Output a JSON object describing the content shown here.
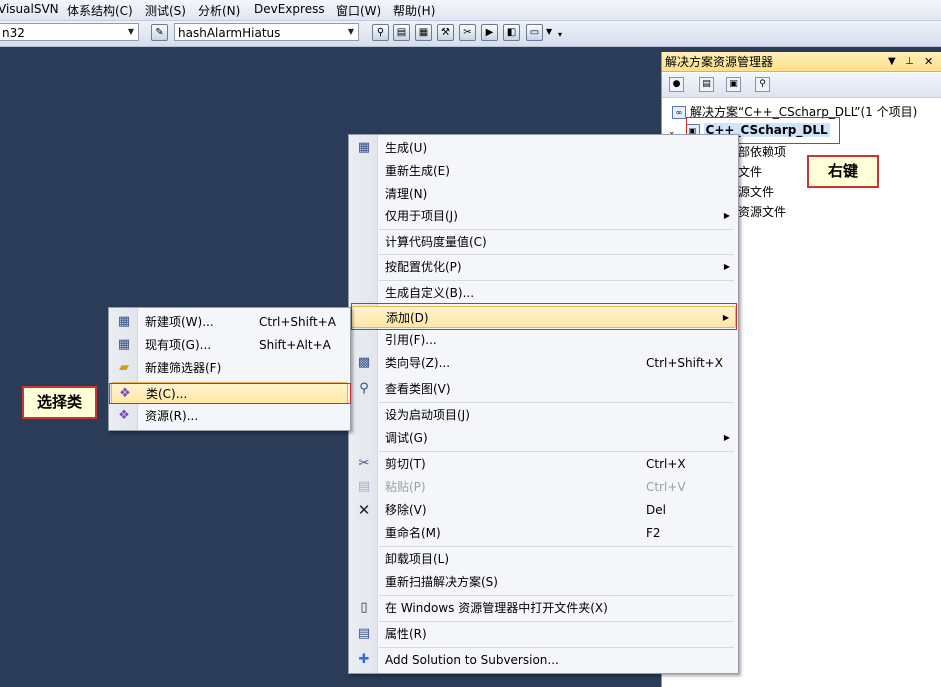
{
  "menubar": {
    "items": [
      "VisualSVN",
      "体系结构(C)",
      "测试(S)",
      "分析(N)",
      "DevExpress",
      "窗口(W)",
      "帮助(H)"
    ]
  },
  "toolbar": {
    "platform_combo": "n32",
    "find_combo": "hashAlarmHiatus"
  },
  "solution_explorer": {
    "title": "解决方案资源管理器",
    "solution_label": "解决方案“C++_CScharp_DLL”(1 个项目)",
    "project_label": "C++_CScharp_DLL",
    "children": [
      "部依赖项",
      "文件",
      "源文件",
      "资源文件"
    ]
  },
  "callouts": {
    "right_click": "右键",
    "select_class": "选择类"
  },
  "context_menu": {
    "items": [
      {
        "label": "生成(U)",
        "icon": "build-icon"
      },
      {
        "label": "重新生成(E)"
      },
      {
        "label": "清理(N)"
      },
      {
        "label": "仅用于项目(J)",
        "submenu": true
      },
      {
        "label": "计算代码度量值(C)"
      },
      {
        "label": "按配置优化(P)",
        "submenu": true
      },
      {
        "label": "生成自定义(B)..."
      },
      {
        "label": "添加(D)",
        "submenu": true,
        "highlighted": true
      },
      {
        "label": "引用(F)..."
      },
      {
        "label": "类向导(Z)...",
        "shortcut": "Ctrl+Shift+X",
        "icon": "class-wizard-icon"
      },
      {
        "label": "查看类图(V)",
        "icon": "class-diagram-icon"
      },
      {
        "label": "设为启动项目(J)"
      },
      {
        "label": "调试(G)",
        "submenu": true
      },
      {
        "label": "剪切(T)",
        "shortcut": "Ctrl+X",
        "icon": "cut-icon"
      },
      {
        "label": "粘贴(P)",
        "shortcut": "Ctrl+V",
        "icon": "paste-icon",
        "disabled": true
      },
      {
        "label": "移除(V)",
        "shortcut": "Del",
        "icon": "remove-icon"
      },
      {
        "label": "重命名(M)",
        "shortcut": "F2"
      },
      {
        "label": "卸载项目(L)"
      },
      {
        "label": "重新扫描解决方案(S)"
      },
      {
        "label": "在 Windows 资源管理器中打开文件夹(X)",
        "icon": "open-folder-icon"
      },
      {
        "label": "属性(R)",
        "icon": "properties-icon"
      },
      {
        "label": "Add Solution to Subversion...",
        "icon": "subversion-add-icon"
      }
    ]
  },
  "add_submenu": {
    "items": [
      {
        "label": "新建项(W)...",
        "shortcut": "Ctrl+Shift+A",
        "icon": "new-item-icon"
      },
      {
        "label": "现有项(G)...",
        "shortcut": "Shift+Alt+A",
        "icon": "existing-item-icon"
      },
      {
        "label": "新建筛选器(F)",
        "icon": "new-filter-icon"
      },
      {
        "label": "类(C)...",
        "icon": "class-icon",
        "highlighted": true
      },
      {
        "label": "资源(R)...",
        "icon": "resource-icon"
      }
    ]
  }
}
